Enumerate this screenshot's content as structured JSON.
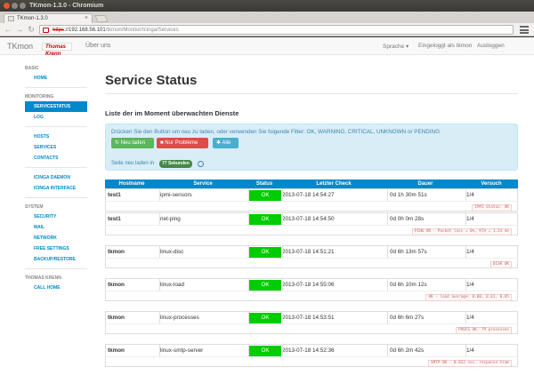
{
  "window": {
    "title": "TKmon-1.3.0 - Chromium"
  },
  "tab": {
    "title": "TKmon-1.3.0"
  },
  "address": {
    "scheme": "https",
    "host": "://192.168.56.101",
    "path": "/tkmon/Monitor/Icinga/Services"
  },
  "appnav": {
    "brand": "TKmon",
    "logo": "Thomas Krenn",
    "about": "Über uns",
    "language": "Sprache ▾",
    "loggedin": "Eingeloggt als tkmon",
    "logout": "Ausloggen"
  },
  "sidebar": {
    "basic": "BASIC",
    "home": "HOME",
    "monitoring": "MONITORING",
    "servicestatus": "SERVICESTATUS",
    "log": "LOG",
    "hosts": "HOSTS",
    "services": "SERVICES",
    "contacts": "CONTACTS",
    "icinga_daemon": "ICINGA DAEMON",
    "icinga_interface": "ICINGA INTERFACE",
    "system": "SYSTEM",
    "security": "SECURITY",
    "mail": "MAIL",
    "network": "NETWORK",
    "free_settings": "FREE SETTINGS",
    "backup": "BACKUP/RESTORE",
    "tk": "THOMAS KRENN",
    "call_home": "CALL HOME"
  },
  "main": {
    "title": "Service Status",
    "section": "Liste der im Moment überwachten Dienste",
    "info": "Drücken Sie den Button um neu zu laden, oder verwenden Sie folgende Filter: OK, WARNING, CRITICAL, UNKNOWN or PENDING",
    "btn_reload": "Neu laden",
    "btn_problems": "Nur Probleme",
    "btn_all": "Alle",
    "reload_text": "Seite neu laden in",
    "countdown": "77 Sekunden"
  },
  "table": {
    "headers": {
      "host": "Hostname",
      "service": "Service",
      "status": "Status",
      "check": "Letzter Check",
      "duration": "Dauer",
      "attempt": "Versuch"
    },
    "rows": [
      {
        "host": "test1",
        "service": "ipmi-sensors",
        "status": "OK",
        "check": "2013-07-18 14:54:27",
        "duration": "0d 1h 30m 51s",
        "attempt": "1/4",
        "output": "IPMI Status: OK"
      },
      {
        "host": "test1",
        "service": "net-ping",
        "status": "OK",
        "check": "2013-07-18 14:54:50",
        "duration": "0d 0h 0m 28s",
        "attempt": "1/4",
        "output": "PING OK - Packet loss = 0%, RTA = 1.24 ms"
      },
      {
        "host": "tkmon",
        "service": "linux-disc",
        "status": "OK",
        "check": "2013-07-18 14:51:21",
        "duration": "0d 6h 13m 57s",
        "attempt": "1/4",
        "output": "DISK OK"
      },
      {
        "host": "tkmon",
        "service": "linux-load",
        "status": "OK",
        "check": "2013-07-18 14:55:06",
        "duration": "0d 6h 10m 12s",
        "attempt": "1/4",
        "output": "OK - load average: 0.00, 0.01, 0.05"
      },
      {
        "host": "tkmon",
        "service": "linux-processes",
        "status": "OK",
        "check": "2013-07-18 14:53:51",
        "duration": "0d 6h 6m 27s",
        "attempt": "1/4",
        "output": "PROCS OK: 79 processes"
      },
      {
        "host": "tkmon",
        "service": "linux-smtp-server",
        "status": "OK",
        "check": "2013-07-18 14:52:36",
        "duration": "0d 6h 2m 42s",
        "attempt": "1/4",
        "output": "SMTP OK - 0.012 sec. response time"
      }
    ]
  }
}
